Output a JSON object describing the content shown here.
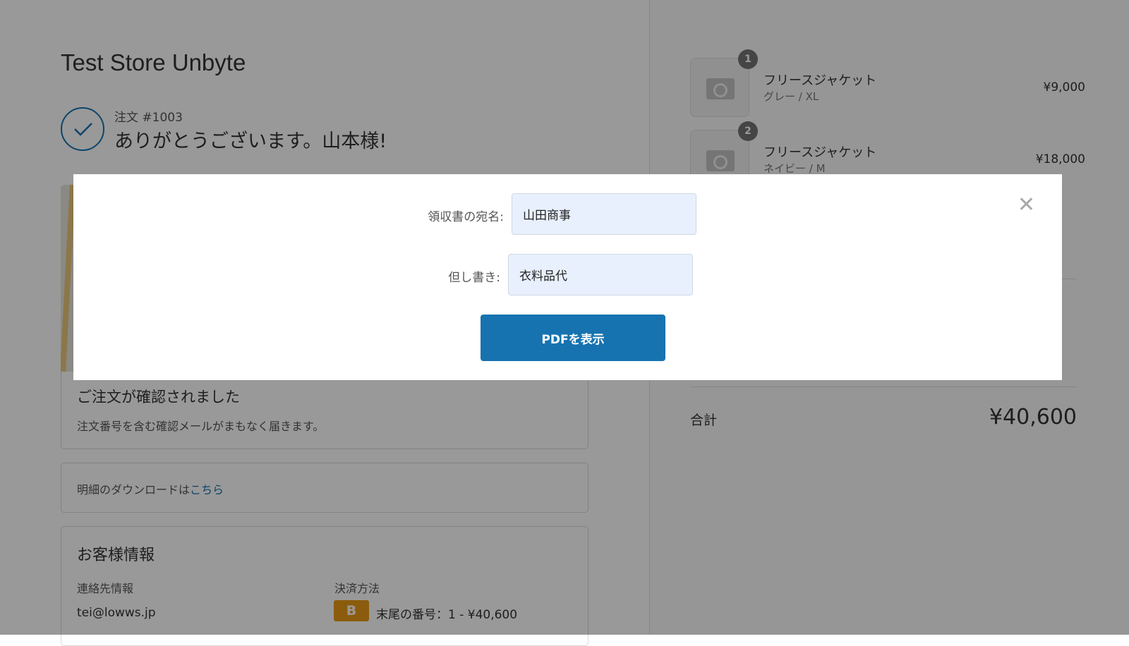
{
  "store_name": "Test Store Unbyte",
  "order": {
    "number": "注文 #1003",
    "thanks": "ありがとうございます。山本様!"
  },
  "confirm": {
    "title": "ご注文が確認されました",
    "text": "注文番号を含む確認メールがまもなく届きます。"
  },
  "download": {
    "text": "明細のダウンロードは",
    "link": "こちら"
  },
  "customer": {
    "title": "お客様情報",
    "contact_label": "連絡先情報",
    "email": "tei@lowws.jp",
    "payment_label": "決済方法",
    "payment_badge": "B",
    "payment_value": "末尾の番号：1 - ¥40,600"
  },
  "items": [
    {
      "qty": "1",
      "name": "フリースジャケット",
      "variant": "グレー / XL",
      "price": "¥9,000"
    },
    {
      "qty": "2",
      "name": "フリースジャケット",
      "variant": "ネイビー / M",
      "price": "¥18,000"
    }
  ],
  "summary": {
    "total_label": "合計",
    "total_value": "¥40,600"
  },
  "modal": {
    "name_label": "領収書の宛名:",
    "name_value": "山田商事",
    "note_label": "但し書き:",
    "note_value": "衣料品代",
    "pdf_button": "PDFを表示",
    "close": "✕"
  }
}
